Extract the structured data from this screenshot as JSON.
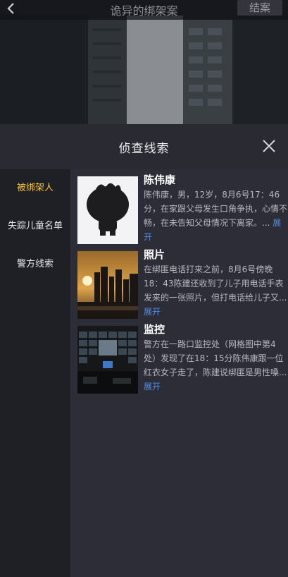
{
  "header": {
    "title": "诡异的绑架案",
    "end_label": "结案"
  },
  "panel": {
    "title": "侦查线索"
  },
  "sidebar": {
    "items": [
      {
        "label": "被绑架人"
      },
      {
        "label": "失踪儿童名单"
      },
      {
        "label": "警方线索"
      }
    ]
  },
  "clues": [
    {
      "title": "陈伟康",
      "desc": "陈伟康，男，12岁，8月6号17：46分，在家跟父母发生口角争执，心情不畅，在未告知父母情况下离家。...",
      "expand": "展开"
    },
    {
      "title": "照片",
      "desc": "在绑匪电话打来之前，8月6号傍晚18：43陈建还收到了儿子用电话手表发来的一张照片，但打电话给儿子又...",
      "expand": "展开"
    },
    {
      "title": "监控",
      "desc": "警方在一路口监控处（网格图中第4处）发现了在18：15分陈伟康跟一位红衣女子走了，陈建说绑匪是男性嗓...",
      "expand": "展开"
    }
  ],
  "colors": {
    "accent": "#f4c430",
    "link": "#4f8fe6",
    "panel_bg": "#2a2a33",
    "sidebar_bg": "#1f1f26"
  },
  "icons": {
    "back": "chevron-left-icon",
    "close": "close-icon"
  }
}
